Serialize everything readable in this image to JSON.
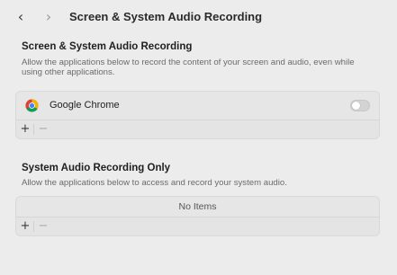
{
  "toolbar": {
    "back_icon": "chevron-left-icon",
    "forward_icon": "chevron-right-icon",
    "title": "Screen & System Audio Recording"
  },
  "screen_section": {
    "heading": "Screen & System Audio Recording",
    "description": "Allow the applications below to record the content of your screen and audio, even while using other applications.",
    "apps": [
      {
        "name": "Google Chrome",
        "icon": "google-chrome-icon",
        "enabled": false
      }
    ],
    "add_label": "+",
    "remove_label": "−"
  },
  "audio_section": {
    "heading": "System Audio Recording Only",
    "description": "Allow the applications below to access and record your system audio.",
    "empty_text": "No Items",
    "add_label": "+",
    "remove_label": "−"
  }
}
